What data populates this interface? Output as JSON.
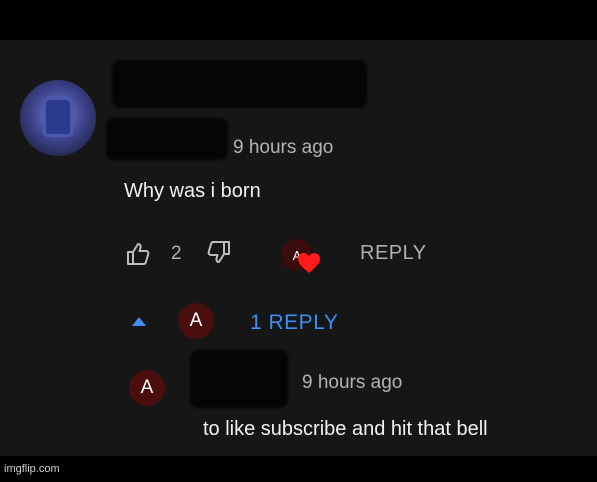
{
  "comment": {
    "timestamp": "9 hours ago",
    "text": "Why was i born",
    "like_count": "2",
    "reply_label": "REPLY"
  },
  "creator_heart": {
    "avatar_letter": "A",
    "heart_color": "#ff1a1a"
  },
  "replies_toggle": {
    "avatar_letter": "A",
    "label": "1 REPLY",
    "color": "#3e8ef0"
  },
  "reply": {
    "avatar_letter": "A",
    "timestamp": "9 hours ago",
    "text": "to like subscribe and hit that bell"
  },
  "watermark": "imgflip.com"
}
